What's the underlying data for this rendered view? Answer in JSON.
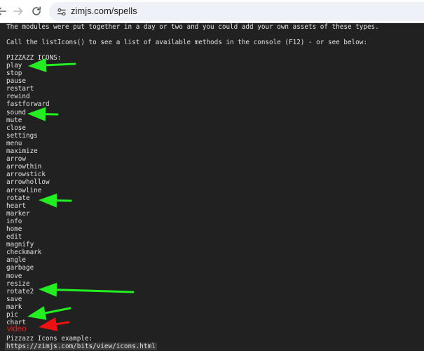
{
  "browser": {
    "url": "zimjs.com/spells",
    "back_icon": "arrow-left-icon",
    "forward_icon": "arrow-right-icon",
    "reload_icon": "reload-icon",
    "site_info_icon": "tune-icon"
  },
  "page": {
    "intro_line": "The modules were put together in a day or two and you could add your own assets of these types.",
    "call_line": "Call the listIcons() to see a list of available methods in the console (F12) - or see below:",
    "heading": "PIZZAZZ ICONS:",
    "icons": [
      "play",
      "stop",
      "pause",
      "restart",
      "rewind",
      "fastforward",
      "sound",
      "mute",
      "close",
      "settings",
      "menu",
      "maximize",
      "arrow",
      "arrowthin",
      "arrowstick",
      "arrowhollow",
      "arrowline",
      "rotate",
      "heart",
      "marker",
      "info",
      "home",
      "edit",
      "magnify",
      "checkmark",
      "angle",
      "garbage",
      "move",
      "resize",
      "rotate2",
      "save",
      "mark",
      "pic",
      "chart"
    ],
    "example_label": "Pizzazz Icons example:",
    "example_url": "https://zimjs.com/bits/view/icons.html"
  },
  "annotations": {
    "arrow_color_green": "#22ee22",
    "arrow_color_red": "#ee1111",
    "suggestion_text": "video"
  }
}
